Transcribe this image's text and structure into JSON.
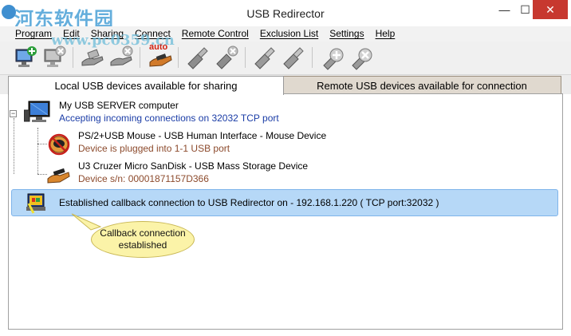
{
  "window": {
    "title": "USB Redirector",
    "watermark": "河东软件园",
    "watermark_url": "www.pc0359.cn",
    "controls": {
      "minimize": "—",
      "maximize": "☐",
      "close": "✕"
    }
  },
  "menu": [
    "Program",
    "Edit",
    "Sharing",
    "Connect",
    "Remote Control",
    "Exclusion List",
    "Settings",
    "Help"
  ],
  "toolbar": {
    "auto_label": "auto",
    "buttons": [
      "add-server",
      "remove-server",
      "share-device",
      "unshare-device",
      "auto-share",
      "connect-device",
      "disconnect-device",
      "connect-remote",
      "disconnect-remote",
      "add-callback",
      "remove-callback"
    ]
  },
  "tabs": {
    "local": "Local USB devices available for sharing",
    "remote": "Remote USB devices available for connection"
  },
  "tree": {
    "server": {
      "expander": "−",
      "name": "My USB SERVER computer",
      "status": "Accepting incoming connections on 32032 TCP port"
    },
    "devices": [
      {
        "name": "PS/2+USB Mouse - USB Human Interface - Mouse Device",
        "status": "Device is plugged into 1-1 USB port"
      },
      {
        "name": "U3 Cruzer Micro SanDisk - USB Mass Storage Device",
        "status": "Device s/n: 00001871157D366"
      }
    ],
    "callback": {
      "text": "Established callback connection to USB Redirector on - 192.168.1.220 ( TCP port:32032 )"
    }
  },
  "callout": {
    "line1": "Callback connection",
    "line2": "established"
  },
  "colors": {
    "close_button": "#c7382f",
    "selected_row": "#b6d8f7",
    "status_blue": "#1a3ca6",
    "status_brown": "#8c4a2c",
    "callout_fill": "#fbf3a8"
  }
}
